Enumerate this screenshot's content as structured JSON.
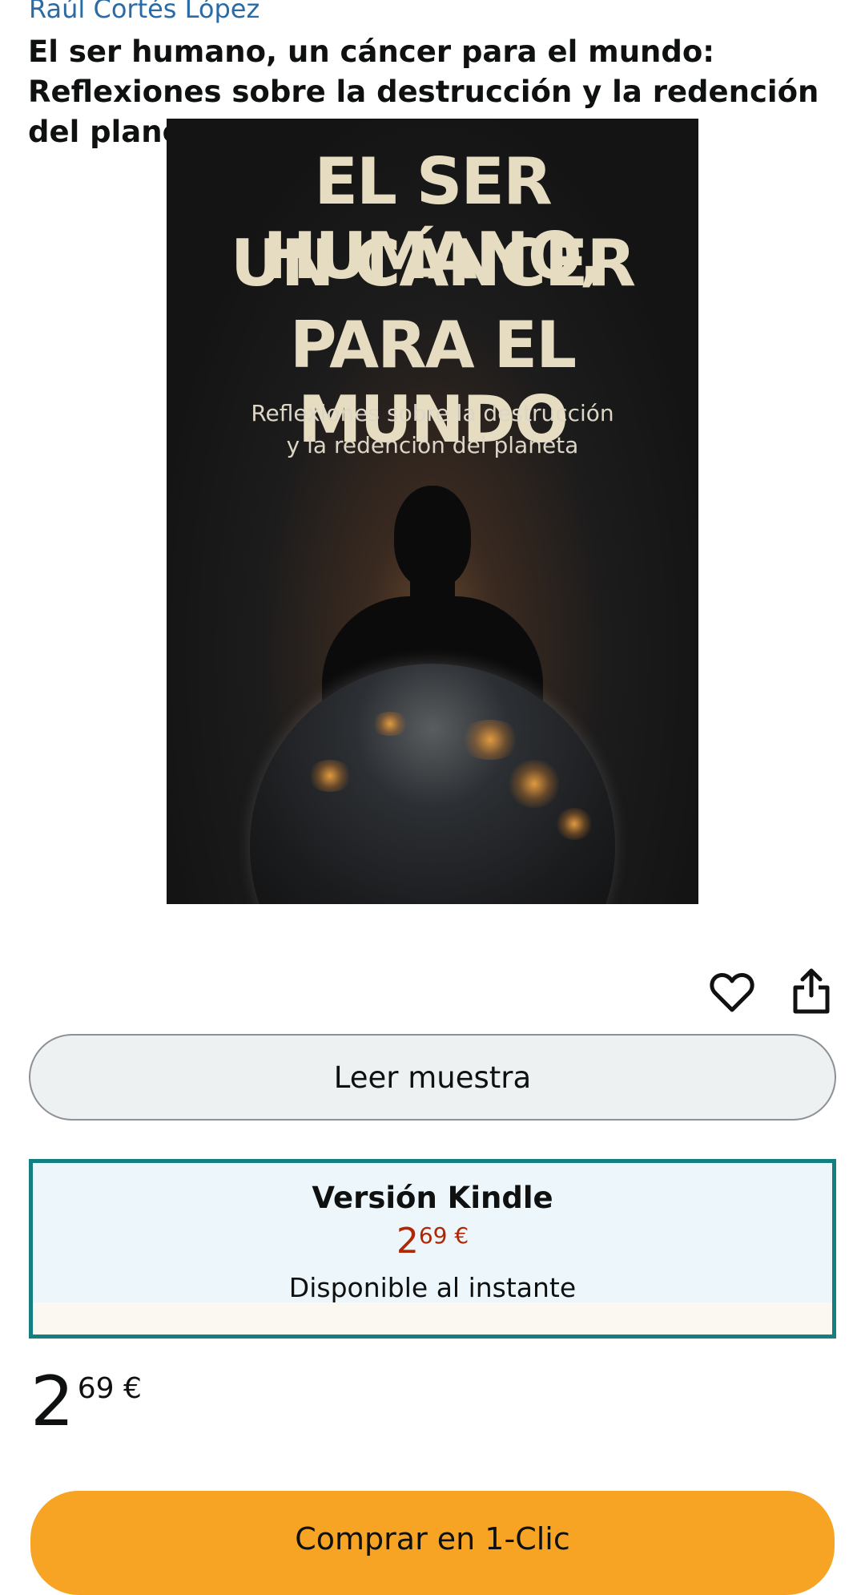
{
  "product": {
    "author": "Raúl Cortés López",
    "title": "El ser humano, un cáncer para el mundo: Reflexiones sobre la destrucción y la redención del planeta"
  },
  "cover": {
    "title_line1": "EL SER HUMANO,",
    "title_line2": "UN CÁNCER",
    "title_line3": "PARA EL MUNDO",
    "subtitle_line1": "Reflexiones sobre la destrucción",
    "subtitle_line2": "y la redención del planeta"
  },
  "actions": {
    "wishlist_icon": "heart-icon",
    "share_icon": "share-icon",
    "read_sample_label": "Leer muestra"
  },
  "format": {
    "name": "Versión Kindle",
    "price_whole": "2",
    "price_fraction": "69 €",
    "availability": "Disponible al instante",
    "border_color": "#137f80",
    "price_color": "#b12704"
  },
  "price": {
    "whole": "2",
    "fraction": "69 €"
  },
  "buy": {
    "label": "Comprar en 1-Clic",
    "color": "#f7a424"
  }
}
